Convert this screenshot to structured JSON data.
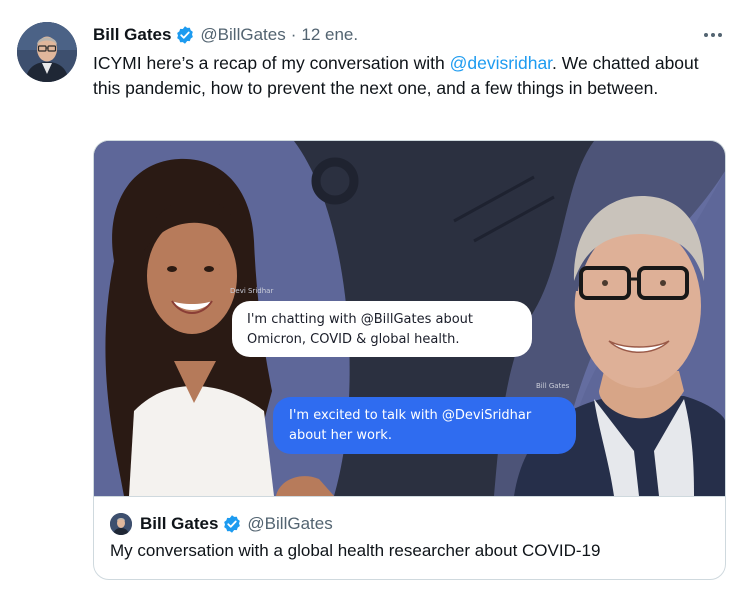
{
  "tweet": {
    "author_name": "Bill Gates",
    "author_handle": "@BillGates",
    "separator": "·",
    "date": "12 ene.",
    "more_icon": "ellipsis-icon",
    "verified_icon": "verified-badge-icon",
    "text_before_mention": "ICYMI here’s a recap of my conversation with ",
    "mention": "@devisridhar",
    "text_after_mention": ". We chatted about this pandemic, how to prevent the next one, and a few things in between."
  },
  "card": {
    "image": {
      "name_tag_left": "Devi Sridhar",
      "name_tag_right": "Bill Gates",
      "bubble_white_line1": "I'm chatting with @BillGates about",
      "bubble_white_line2": "Omicron, COVID & global health.",
      "bubble_blue_line1": "I'm excited to talk with @DeviSridhar",
      "bubble_blue_line2": "about her work."
    },
    "quote_author_name": "Bill Gates",
    "quote_author_handle": "@BillGates",
    "quote_text": "My conversation with a global health researcher about COVID-19"
  },
  "colors": {
    "accent": "#1d9bf0",
    "verified": "#1d9bf0",
    "secondary_text": "#536471",
    "image_background": "#2b3040",
    "image_panel": "#5d6596",
    "bubble_blue": "#2f6cf0"
  }
}
